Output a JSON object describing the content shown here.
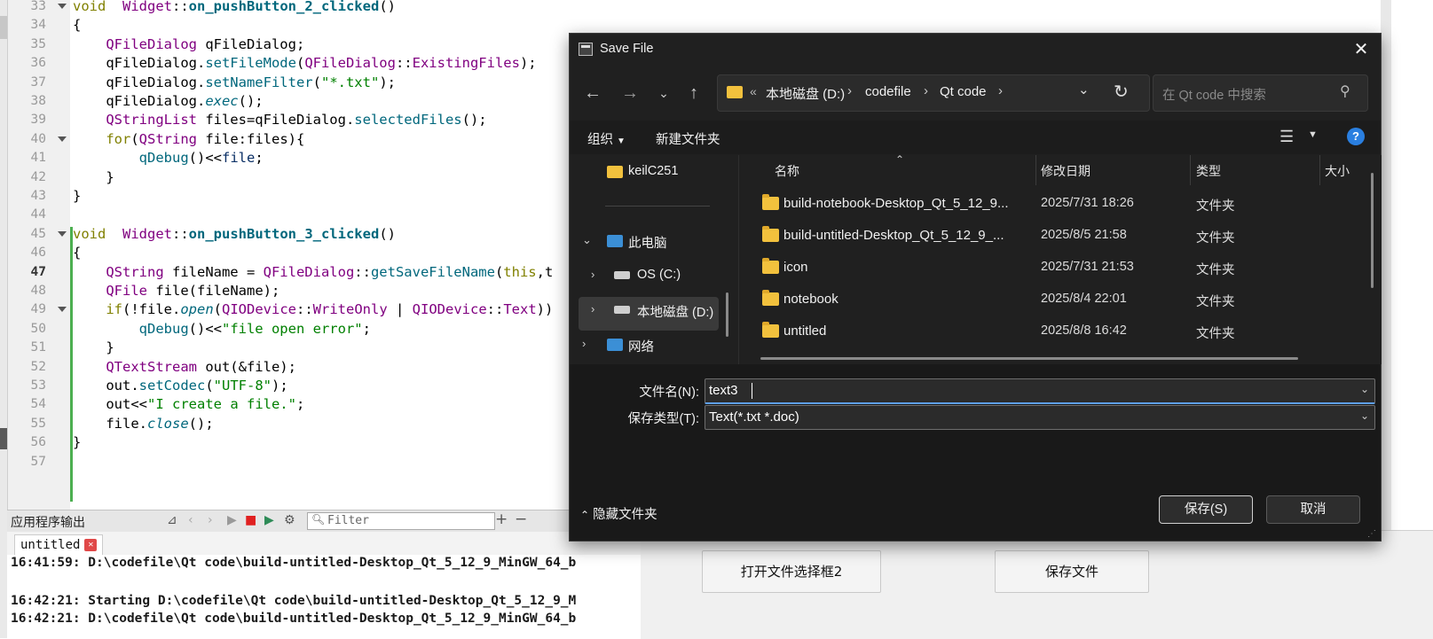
{
  "editor": {
    "lines": [
      {
        "n": "33",
        "fold": true,
        "segs": [
          [
            "kw",
            "void"
          ],
          [
            "",
            "  "
          ],
          [
            "ty",
            "Widget"
          ],
          [
            "",
            "::"
          ],
          [
            "fn",
            "on_pushButton_2_clicked"
          ],
          [
            "",
            "()"
          ]
        ]
      },
      {
        "n": "34",
        "fold": false,
        "segs": [
          [
            "",
            "{"
          ]
        ]
      },
      {
        "n": "35",
        "fold": false,
        "segs": [
          [
            "",
            "    "
          ],
          [
            "ty",
            "QFileDialog"
          ],
          [
            "",
            " qFileDialog;"
          ]
        ]
      },
      {
        "n": "36",
        "fold": false,
        "segs": [
          [
            "",
            "    qFileDialog."
          ],
          [
            "mc",
            "setFileMode"
          ],
          [
            "",
            "("
          ],
          [
            "ty",
            "QFileDialog"
          ],
          [
            "",
            "::"
          ],
          [
            "ty",
            "ExistingFiles"
          ],
          [
            "",
            ");"
          ]
        ]
      },
      {
        "n": "37",
        "fold": false,
        "segs": [
          [
            "",
            "    qFileDialog."
          ],
          [
            "mc",
            "setNameFilter"
          ],
          [
            "",
            "("
          ],
          [
            "st",
            "\"*.txt\""
          ],
          [
            "",
            ");"
          ]
        ]
      },
      {
        "n": "38",
        "fold": false,
        "segs": [
          [
            "",
            "    qFileDialog."
          ],
          [
            "em",
            "exec"
          ],
          [
            "",
            "();"
          ]
        ]
      },
      {
        "n": "39",
        "fold": false,
        "segs": [
          [
            "",
            "    "
          ],
          [
            "ty",
            "QStringList"
          ],
          [
            "",
            " files=qFileDialog."
          ],
          [
            "mc",
            "selectedFiles"
          ],
          [
            "",
            "();"
          ]
        ]
      },
      {
        "n": "40",
        "fold": true,
        "segs": [
          [
            "",
            "    "
          ],
          [
            "kw",
            "for"
          ],
          [
            "",
            "("
          ],
          [
            "ty",
            "QString"
          ],
          [
            "",
            " file:files){"
          ]
        ]
      },
      {
        "n": "41",
        "fold": false,
        "segs": [
          [
            "",
            "        "
          ],
          [
            "mc",
            "qDebug"
          ],
          [
            "",
            "()<<"
          ],
          [
            "va",
            "file"
          ],
          [
            "",
            ";"
          ]
        ]
      },
      {
        "n": "42",
        "fold": false,
        "segs": [
          [
            "",
            "    }"
          ]
        ]
      },
      {
        "n": "43",
        "fold": false,
        "segs": [
          [
            "",
            "}"
          ]
        ]
      },
      {
        "n": "44",
        "fold": false,
        "segs": []
      },
      {
        "n": "45",
        "fold": true,
        "segs": [
          [
            "kw",
            "void"
          ],
          [
            "",
            "  "
          ],
          [
            "ty",
            "Widget"
          ],
          [
            "",
            "::"
          ],
          [
            "fn",
            "on_pushButton_3_clicked"
          ],
          [
            "",
            "()"
          ]
        ]
      },
      {
        "n": "46",
        "fold": false,
        "segs": [
          [
            "",
            "{"
          ]
        ]
      },
      {
        "n": "47",
        "fold": false,
        "cur": true,
        "segs": [
          [
            "",
            "    "
          ],
          [
            "ty",
            "QString"
          ],
          [
            "",
            " fileName = "
          ],
          [
            "ty",
            "QFileDialog"
          ],
          [
            "",
            "::"
          ],
          [
            "mc",
            "getSaveFileName"
          ],
          [
            "",
            "("
          ],
          [
            "kw",
            "this"
          ],
          [
            "",
            ",t"
          ]
        ]
      },
      {
        "n": "48",
        "fold": false,
        "segs": [
          [
            "",
            "    "
          ],
          [
            "ty",
            "QFile"
          ],
          [
            "",
            " file(fileName);"
          ]
        ]
      },
      {
        "n": "49",
        "fold": true,
        "segs": [
          [
            "",
            "    "
          ],
          [
            "kw",
            "if"
          ],
          [
            "",
            "(!file."
          ],
          [
            "em",
            "open"
          ],
          [
            "",
            "("
          ],
          [
            "ty",
            "QIODevice"
          ],
          [
            "",
            "::"
          ],
          [
            "ty",
            "WriteOnly"
          ],
          [
            "",
            " | "
          ],
          [
            "ty",
            "QIODevice"
          ],
          [
            "",
            "::"
          ],
          [
            "ty",
            "Text"
          ],
          [
            "",
            "))"
          ]
        ]
      },
      {
        "n": "50",
        "fold": false,
        "segs": [
          [
            "",
            "        "
          ],
          [
            "mc",
            "qDebug"
          ],
          [
            "",
            "()<<"
          ],
          [
            "st",
            "\"file open error\""
          ],
          [
            "",
            ";"
          ]
        ]
      },
      {
        "n": "51",
        "fold": false,
        "segs": [
          [
            "",
            "    }"
          ]
        ]
      },
      {
        "n": "52",
        "fold": false,
        "segs": [
          [
            "",
            "    "
          ],
          [
            "ty",
            "QTextStream"
          ],
          [
            "",
            " out(&file);"
          ]
        ]
      },
      {
        "n": "53",
        "fold": false,
        "segs": [
          [
            "",
            "    out."
          ],
          [
            "mc",
            "setCodec"
          ],
          [
            "",
            "("
          ],
          [
            "st",
            "\"UTF-8\""
          ],
          [
            "",
            ");"
          ]
        ]
      },
      {
        "n": "54",
        "fold": false,
        "segs": [
          [
            "",
            "    out<<"
          ],
          [
            "st",
            "\"I create a file.\""
          ],
          [
            "",
            ";"
          ]
        ]
      },
      {
        "n": "55",
        "fold": false,
        "segs": [
          [
            "",
            "    file."
          ],
          [
            "em",
            "close"
          ],
          [
            "",
            "();"
          ]
        ]
      },
      {
        "n": "56",
        "fold": false,
        "segs": [
          [
            "",
            "}"
          ]
        ]
      },
      {
        "n": "57",
        "fold": false,
        "segs": []
      }
    ]
  },
  "output": {
    "title": "应用程序输出",
    "filter_placeholder": "Filter",
    "tab_label": "untitled",
    "lines": [
      "16:41:59: D:\\codefile\\Qt code\\build-untitled-Desktop_Qt_5_12_9_MinGW_64_b",
      "",
      "16:42:21: Starting D:\\codefile\\Qt code\\build-untitled-Desktop_Qt_5_12_9_M",
      "16:42:21: D:\\codefile\\Qt code\\build-untitled-Desktop_Qt_5_12_9_MinGW_64_b"
    ]
  },
  "app": {
    "button_open2": "打开文件选择框2",
    "button_save": "保存文件"
  },
  "dialog": {
    "title": "Save File",
    "address": {
      "crumbs": [
        "本地磁盘 (D:)",
        "codefile",
        "Qt code"
      ]
    },
    "search_placeholder": "在 Qt code 中搜索",
    "commands": {
      "organize": "组织",
      "new_folder": "新建文件夹"
    },
    "nav": {
      "keil": "keilC251",
      "this_pc": "此电脑",
      "drive_c": "OS (C:)",
      "drive_d": "本地磁盘 (D:)",
      "network": "网络"
    },
    "columns": {
      "name": "名称",
      "date": "修改日期",
      "type": "类型",
      "size": "大小"
    },
    "files": [
      {
        "name": "build-notebook-Desktop_Qt_5_12_9...",
        "date": "2025/7/31 18:26",
        "type": "文件夹"
      },
      {
        "name": "build-untitled-Desktop_Qt_5_12_9_...",
        "date": "2025/8/5 21:58",
        "type": "文件夹"
      },
      {
        "name": "icon",
        "date": "2025/7/31 21:53",
        "type": "文件夹"
      },
      {
        "name": "notebook",
        "date": "2025/8/4 22:01",
        "type": "文件夹"
      },
      {
        "name": "untitled",
        "date": "2025/8/8 16:42",
        "type": "文件夹"
      }
    ],
    "filename_label": "文件名(N):",
    "filename_value": "text3",
    "filetype_label": "保存类型(T):",
    "filetype_value": "Text(*.txt *.doc)",
    "hide_folders": "隐藏文件夹",
    "save_button": "保存(S)",
    "cancel_button": "取消"
  }
}
